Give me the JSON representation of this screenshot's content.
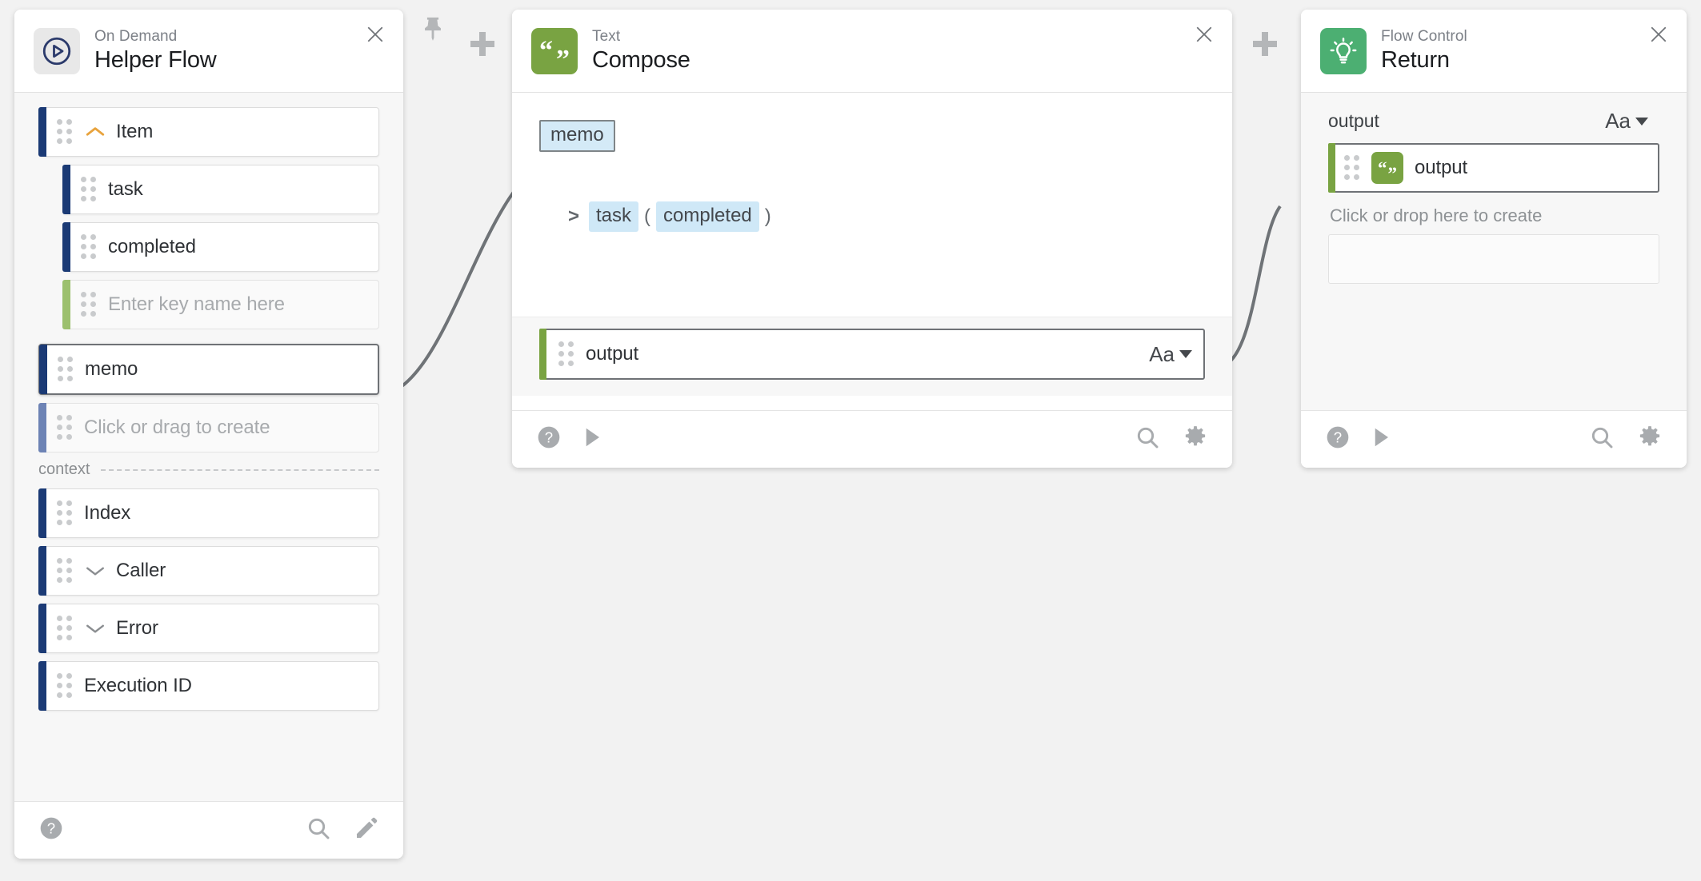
{
  "canvas": {
    "background": "#f2f2f2",
    "icons": [
      {
        "name": "pin-icon",
        "label": "Pin"
      },
      {
        "name": "add-node-icon-1",
        "label": "+"
      },
      {
        "name": "add-node-icon-2",
        "label": "+"
      }
    ]
  },
  "helper_flow": {
    "kicker": "On Demand",
    "title": "Helper Flow",
    "close_label": "✕",
    "icon": "play-circle-icon",
    "rows": [
      {
        "label": "Item",
        "bar": "bar-navy",
        "chevron": "up",
        "indent": false,
        "muted": false,
        "selected": false,
        "ghost": false
      },
      {
        "label": "task",
        "bar": "bar-navy",
        "chevron": "none",
        "indent": true,
        "muted": false,
        "selected": false,
        "ghost": false
      },
      {
        "label": "completed",
        "bar": "bar-navy",
        "chevron": "none",
        "indent": true,
        "muted": false,
        "selected": false,
        "ghost": false
      },
      {
        "label": "Enter key name here",
        "bar": "bar-ltgreen",
        "chevron": "none",
        "indent": true,
        "muted": true,
        "selected": false,
        "ghost": true
      },
      {
        "label": "memo",
        "bar": "bar-navy",
        "chevron": "none",
        "indent": false,
        "muted": false,
        "selected": true,
        "ghost": false
      },
      {
        "label": "Click or drag to create",
        "bar": "bar-slate",
        "chevron": "none",
        "indent": false,
        "muted": true,
        "selected": false,
        "ghost": true
      }
    ],
    "section_label": "context",
    "context_rows": [
      {
        "label": "Index",
        "bar": "bar-navy",
        "chevron": "none",
        "indent": false,
        "muted": false,
        "selected": false,
        "ghost": false
      },
      {
        "label": "Caller",
        "bar": "bar-navy",
        "chevron": "down",
        "indent": false,
        "muted": false,
        "selected": false,
        "ghost": false
      },
      {
        "label": "Error",
        "bar": "bar-navy",
        "chevron": "down",
        "indent": false,
        "muted": false,
        "selected": false,
        "ghost": false
      },
      {
        "label": "Execution ID",
        "bar": "bar-navy",
        "chevron": "none",
        "indent": false,
        "muted": false,
        "selected": false,
        "ghost": false
      }
    ],
    "footer": {
      "help": "help-icon",
      "search": "search-icon",
      "edit": "pencil-icon"
    }
  },
  "compose": {
    "kicker": "Text",
    "title": "Compose",
    "close_label": "✕",
    "icon": "quote-icon",
    "chip": "memo",
    "expression": {
      "prefix": ">",
      "token_1": "task",
      "open_paren": "(",
      "token_2": "completed",
      "close_paren": ")"
    },
    "output": {
      "label": "output",
      "type_selector": "Aa"
    },
    "footer": {
      "help": "help-icon",
      "run": "play-icon",
      "search": "search-icon",
      "settings": "gear-icon"
    }
  },
  "return_node": {
    "kicker": "Flow Control",
    "title": "Return",
    "close_label": "✕",
    "icon": "lightbulb-icon",
    "field_label": "output",
    "type_selector": "Aa",
    "row_label": "output",
    "hint": "Click or drop here to create",
    "footer": {
      "help": "help-icon",
      "run": "play-icon",
      "search": "search-icon",
      "settings": "gear-icon"
    }
  },
  "colors": {
    "navy": "#1b3a75",
    "slate": "#6d83b5",
    "light_green": "#9cc06e",
    "olive": "#79a342",
    "emerald": "#4caf72",
    "chip_blue": "#d4eaf7",
    "token_blue": "#cfe8f7",
    "accent_orange": "#e8a33d"
  }
}
